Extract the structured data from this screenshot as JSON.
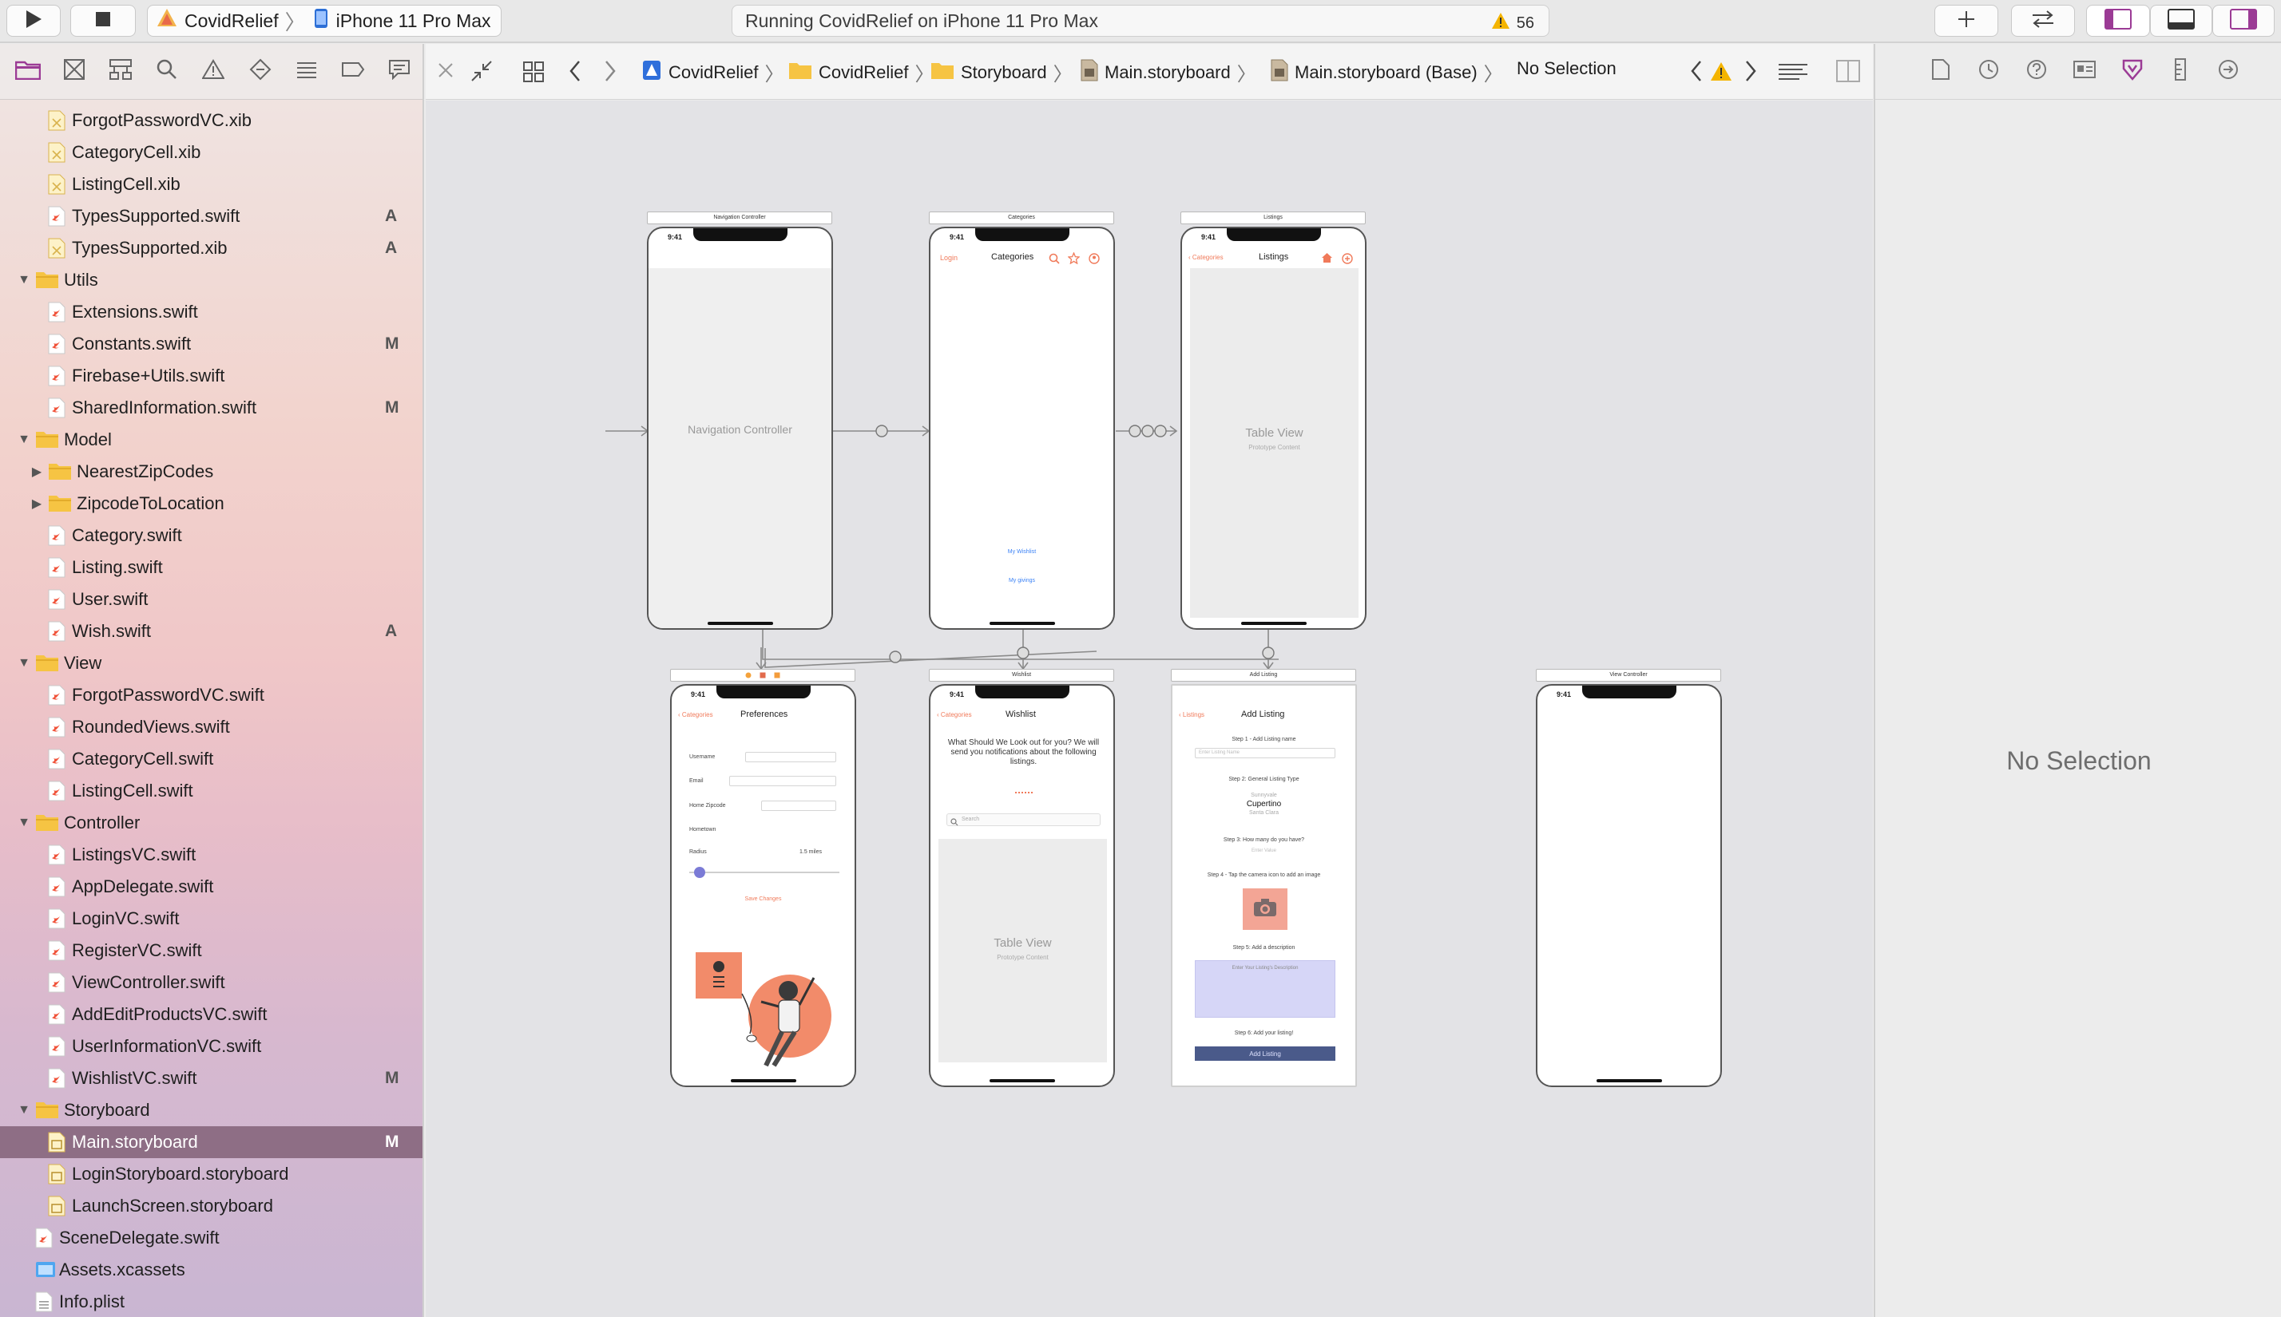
{
  "toolbar": {
    "scheme_name": "CovidRelief",
    "device_name": "iPhone 11 Pro Max",
    "status_text": "Running CovidRelief on iPhone 11 Pro Max",
    "warning_count": "56"
  },
  "navigator": {
    "items": [
      {
        "label": "ForgotPasswordVC.xib",
        "type": "xib",
        "indent": 2,
        "badge": ""
      },
      {
        "label": "CategoryCell.xib",
        "type": "xib",
        "indent": 2,
        "badge": ""
      },
      {
        "label": "ListingCell.xib",
        "type": "xib",
        "indent": 2,
        "badge": ""
      },
      {
        "label": "TypesSupported.swift",
        "type": "swift",
        "indent": 2,
        "badge": "A"
      },
      {
        "label": "TypesSupported.xib",
        "type": "xib",
        "indent": 2,
        "badge": "A"
      },
      {
        "label": "Utils",
        "type": "folder",
        "indent": 1,
        "badge": "",
        "expanded": true
      },
      {
        "label": "Extensions.swift",
        "type": "swift",
        "indent": 2,
        "badge": ""
      },
      {
        "label": "Constants.swift",
        "type": "swift",
        "indent": 2,
        "badge": "M"
      },
      {
        "label": "Firebase+Utils.swift",
        "type": "swift",
        "indent": 2,
        "badge": ""
      },
      {
        "label": "SharedInformation.swift",
        "type": "swift",
        "indent": 2,
        "badge": "M"
      },
      {
        "label": "Model",
        "type": "folder",
        "indent": 1,
        "badge": "",
        "expanded": true
      },
      {
        "label": "NearestZipCodes",
        "type": "folder",
        "indent": 2,
        "badge": "",
        "expanded": false
      },
      {
        "label": "ZipcodeToLocation",
        "type": "folder",
        "indent": 2,
        "badge": "",
        "expanded": false
      },
      {
        "label": "Category.swift",
        "type": "swift",
        "indent": 2,
        "badge": ""
      },
      {
        "label": "Listing.swift",
        "type": "swift",
        "indent": 2,
        "badge": ""
      },
      {
        "label": "User.swift",
        "type": "swift",
        "indent": 2,
        "badge": ""
      },
      {
        "label": "Wish.swift",
        "type": "swift",
        "indent": 2,
        "badge": "A"
      },
      {
        "label": "View",
        "type": "folder",
        "indent": 1,
        "badge": "",
        "expanded": true
      },
      {
        "label": "ForgotPasswordVC.swift",
        "type": "swift",
        "indent": 2,
        "badge": ""
      },
      {
        "label": "RoundedViews.swift",
        "type": "swift",
        "indent": 2,
        "badge": ""
      },
      {
        "label": "CategoryCell.swift",
        "type": "swift",
        "indent": 2,
        "badge": ""
      },
      {
        "label": "ListingCell.swift",
        "type": "swift",
        "indent": 2,
        "badge": ""
      },
      {
        "label": "Controller",
        "type": "folder",
        "indent": 1,
        "badge": "",
        "expanded": true
      },
      {
        "label": "ListingsVC.swift",
        "type": "swift",
        "indent": 2,
        "badge": ""
      },
      {
        "label": "AppDelegate.swift",
        "type": "swift",
        "indent": 2,
        "badge": ""
      },
      {
        "label": "LoginVC.swift",
        "type": "swift",
        "indent": 2,
        "badge": ""
      },
      {
        "label": "RegisterVC.swift",
        "type": "swift",
        "indent": 2,
        "badge": ""
      },
      {
        "label": "ViewController.swift",
        "type": "swift",
        "indent": 2,
        "badge": ""
      },
      {
        "label": "AddEditProductsVC.swift",
        "type": "swift",
        "indent": 2,
        "badge": ""
      },
      {
        "label": "UserInformationVC.swift",
        "type": "swift",
        "indent": 2,
        "badge": ""
      },
      {
        "label": "WishlistVC.swift",
        "type": "swift",
        "indent": 2,
        "badge": "M"
      },
      {
        "label": "Storyboard",
        "type": "folder",
        "indent": 1,
        "badge": "",
        "expanded": true
      },
      {
        "label": "Main.storyboard",
        "type": "storyboard",
        "indent": 2,
        "badge": "M",
        "selected": true
      },
      {
        "label": "LoginStoryboard.storyboard",
        "type": "storyboard",
        "indent": 2,
        "badge": ""
      },
      {
        "label": "LaunchScreen.storyboard",
        "type": "storyboard",
        "indent": 2,
        "badge": ""
      },
      {
        "label": "SceneDelegate.swift",
        "type": "swift",
        "indent": 1,
        "badge": ""
      },
      {
        "label": "Assets.xcassets",
        "type": "assets",
        "indent": 1,
        "badge": ""
      },
      {
        "label": "Info.plist",
        "type": "plist",
        "indent": 1,
        "badge": ""
      }
    ]
  },
  "jumpbar": {
    "crumbs": [
      "CovidRelief",
      "CovidRelief",
      "Storyboard",
      "Main.storyboard",
      "Main.storyboard (Base)",
      "No Selection"
    ]
  },
  "canvas": {
    "scenes": {
      "nav": {
        "title": "Navigation Controller",
        "time": "9:41",
        "center_label": "Navigation Controller"
      },
      "categories": {
        "title": "Categories",
        "time": "9:41",
        "left_button": "Login",
        "nav_title": "Categories",
        "link1": "My Wishlist",
        "link2": "My givings"
      },
      "listings": {
        "title": "Listings",
        "time": "9:41",
        "back": "Categories",
        "nav_title": "Listings",
        "table_label": "Table View",
        "table_sub": "Prototype Content"
      },
      "preferences": {
        "time": "9:41",
        "back": "Categories",
        "nav_title": "Preferences",
        "username": "Username",
        "email": "Email",
        "zip": "Home Zipcode",
        "hometown": "Hometown",
        "radius": "Radius",
        "radius_value": "1.5 miles",
        "save": "Save Changes"
      },
      "wishlist": {
        "title": "Wishlist",
        "time": "9:41",
        "back": "Categories",
        "nav_title": "Wishlist",
        "prompt": "What Should We Look out for you? We will send you notifications about the following listings.",
        "search_placeholder": "Search",
        "table_label": "Table View",
        "table_sub": "Prototype Content"
      },
      "add_listing": {
        "title": "Add Listing",
        "back": "Listings",
        "nav_title": "Add Listing",
        "step1": "Step 1 - Add Listing name",
        "step1_placeholder": "Enter Listing Name",
        "step2": "Step 2: General Listing Type",
        "picker_top": "Sunnyvale",
        "picker_mid": "Cupertino",
        "picker_bot": "Santa Clara",
        "step3": "Step 3: How many do you have?",
        "step3_placeholder": "Enter Value",
        "step4": "Step 4 - Tap the camera icon to add an image",
        "step5": "Step 5: Add a description",
        "desc_placeholder": "Enter Your Listing's Description",
        "step6": "Step 6: Add your listing!",
        "button": "Add Listing"
      },
      "view_controller": {
        "title": "View Controller",
        "time": "9:41"
      }
    }
  },
  "inspector": {
    "empty_text": "No Selection"
  },
  "colors": {
    "accent_orange": "#f07a5a",
    "link_blue": "#3b82f6",
    "selection_row": "#8e6e85",
    "slider": "#7b7bd6",
    "add_button": "#4a5a8a",
    "desc_box": "#d6d6f7"
  }
}
